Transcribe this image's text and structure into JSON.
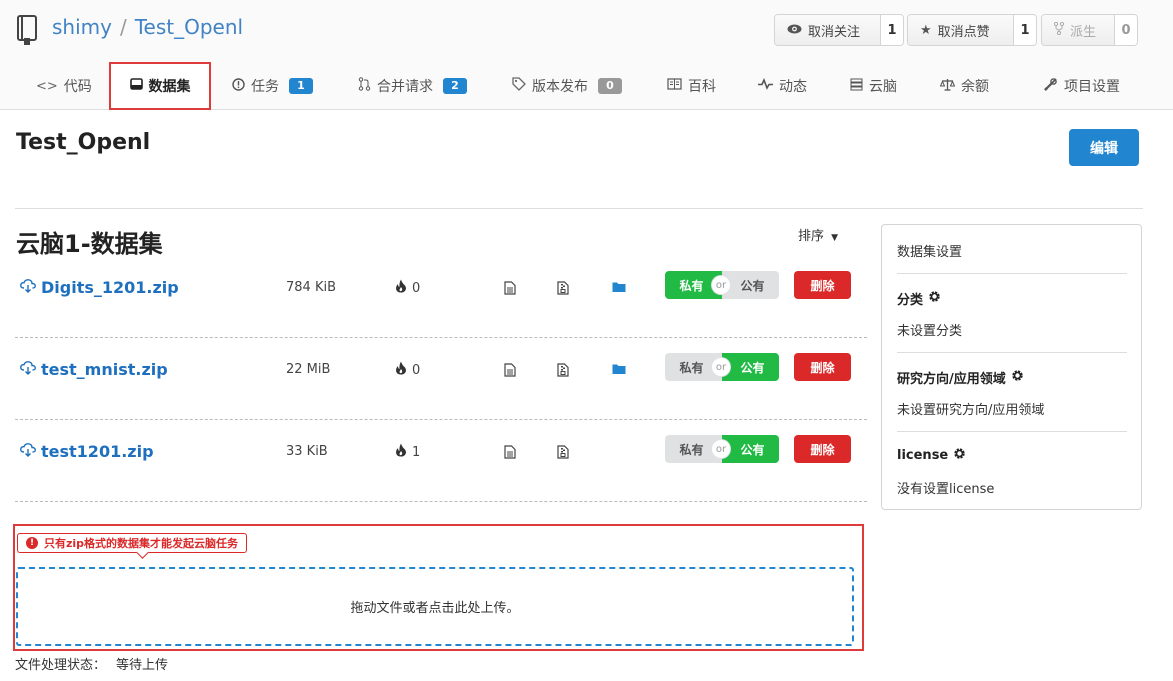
{
  "repo": {
    "owner": "shimy",
    "separator": "/",
    "name": "Test_Openl"
  },
  "header_buttons": {
    "watch": {
      "label": "取消关注",
      "count": "1"
    },
    "star": {
      "label": "取消点赞",
      "count": "1"
    },
    "fork": {
      "label": "派生",
      "count": "0"
    }
  },
  "tabs": [
    {
      "label": "代码",
      "icon": "code-icon"
    },
    {
      "label": "数据集",
      "icon": "dataset-icon",
      "active": true
    },
    {
      "label": "任务",
      "icon": "issue-icon",
      "badge": "1"
    },
    {
      "label": "合并请求",
      "icon": "pull-request-icon",
      "badge": "2"
    },
    {
      "label": "版本发布",
      "icon": "tag-icon",
      "badge": "0"
    },
    {
      "label": "百科",
      "icon": "wiki-icon"
    },
    {
      "label": "动态",
      "icon": "pulse-icon"
    },
    {
      "label": "云脑",
      "icon": "server-icon"
    },
    {
      "label": "余额",
      "icon": "balance-icon"
    },
    {
      "label": "项目设置",
      "icon": "tools-icon"
    }
  ],
  "main": {
    "title": "Test_Openl",
    "edit_label": "编辑",
    "section_title": "云脑1-数据集",
    "sort_label": "排序"
  },
  "datasets": [
    {
      "name": "Digits_1201.zip",
      "size": "784 KiB",
      "downloads": "0",
      "private_label": "私有",
      "or_label": "or",
      "public_label": "公有",
      "visibility": "private",
      "has_folder": true,
      "delete_label": "删除"
    },
    {
      "name": "test_mnist.zip",
      "size": "22 MiB",
      "downloads": "0",
      "private_label": "私有",
      "or_label": "or",
      "public_label": "公有",
      "visibility": "public",
      "has_folder": true,
      "delete_label": "删除"
    },
    {
      "name": "test1201.zip",
      "size": "33 KiB",
      "downloads": "1",
      "private_label": "私有",
      "or_label": "or",
      "public_label": "公有",
      "visibility": "public",
      "has_folder": false,
      "delete_label": "删除"
    }
  ],
  "upload": {
    "warning": "只有zip格式的数据集才能发起云脑任务",
    "dropzone_text": "拖动文件或者点击此处上传。",
    "status_label": "文件处理状态：",
    "status_value": "等待上传"
  },
  "sidebar": {
    "heading": "数据集设置",
    "category_label": "分类",
    "category_value": "未设置分类",
    "research_label": "研究方向/应用领域",
    "research_value": "未设置研究方向/应用领域",
    "license_label": "license",
    "license_value": "没有设置license"
  },
  "colors": {
    "primary": "#2185d0",
    "danger": "#db2828",
    "success": "#21ba45",
    "link": "#1e70bf",
    "highlight": "#e03b3b"
  }
}
